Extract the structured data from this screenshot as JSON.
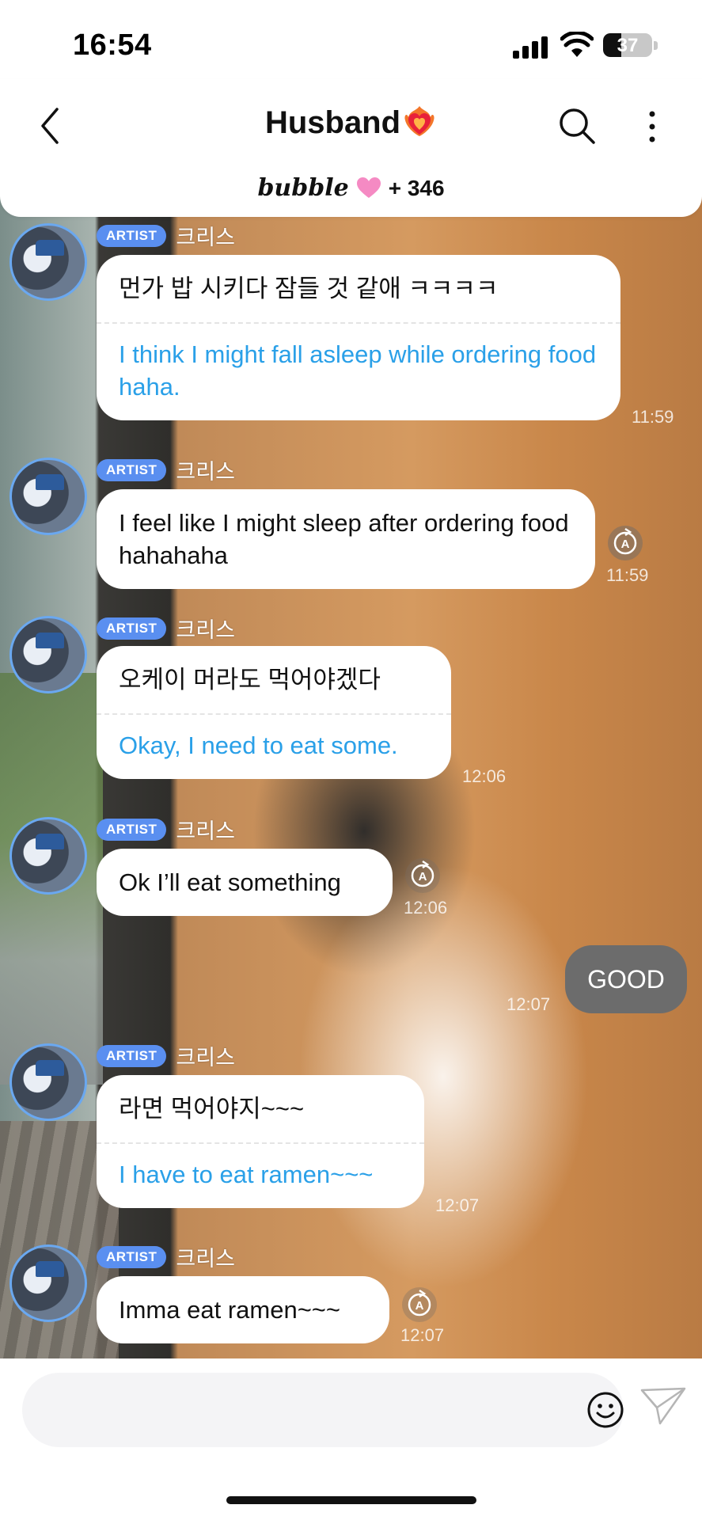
{
  "status_bar": {
    "time": "16:54",
    "battery": "37",
    "battery_level": 0.37
  },
  "header": {
    "title": "Husband",
    "subtitle_brand": "bubble",
    "subtitle_count": "+ 346"
  },
  "messages": [
    {
      "badge": "ARTIST",
      "sender": "크리스",
      "korean": "먼가 밥 시키다 잠들 것 같애 ㅋㅋㅋㅋ",
      "english": "I think I might fall asleep while ordering food haha.",
      "time": "11:59"
    },
    {
      "badge": "ARTIST",
      "sender": "크리스",
      "text": "I feel like I might sleep after ordering food hahahaha",
      "time": "11:59"
    },
    {
      "badge": "ARTIST",
      "sender": "크리스",
      "korean": "오케이 머라도 먹어야겠다",
      "english": "Okay, I need to eat some.",
      "time": "12:06"
    },
    {
      "badge": "ARTIST",
      "sender": "크리스",
      "text": "Ok I’ll eat something",
      "time": "12:06"
    },
    {
      "outgoing": true,
      "text": "GOOD",
      "time": "12:07"
    },
    {
      "badge": "ARTIST",
      "sender": "크리스",
      "korean": "라면 먹어야지~~~",
      "english": "I have to eat ramen~~~",
      "time": "12:07"
    },
    {
      "badge": "ARTIST",
      "sender": "크리스",
      "text": "Imma eat ramen~~~",
      "time": "12:07"
    }
  ],
  "composer": {
    "placeholder": ""
  },
  "colors": {
    "accent": "#2aa0e8",
    "badge": "#5a8ff0",
    "outgoing_bubble": "#6c6c6c"
  }
}
